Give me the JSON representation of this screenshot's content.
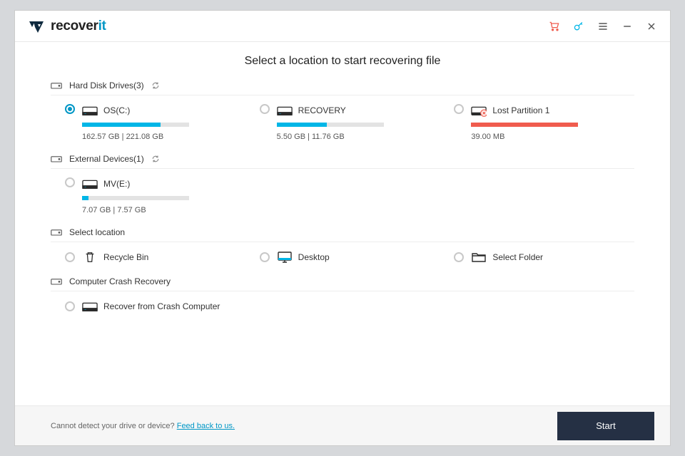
{
  "brand": {
    "left": "recover",
    "right": "it"
  },
  "page_title": "Select a location to start recovering file",
  "sections": {
    "hdd": {
      "title": "Hard Disk Drives(3)"
    },
    "ext": {
      "title": "External Devices(1)"
    },
    "sel": {
      "title": "Select location"
    },
    "crash": {
      "title": "Computer Crash Recovery"
    }
  },
  "hdd_items": [
    {
      "name": "OS(C:)",
      "size": "162.57  GB | 221.08  GB",
      "pct": 73,
      "selected": true,
      "red": false
    },
    {
      "name": "RECOVERY",
      "size": "5.50  GB | 11.76  GB",
      "pct": 47,
      "selected": false,
      "red": false
    },
    {
      "name": "Lost Partition 1",
      "size": "39.00  MB",
      "pct": 100,
      "selected": false,
      "red": true
    }
  ],
  "ext_items": [
    {
      "name": "MV(E:)",
      "size": "7.07  GB | 7.57  GB",
      "pct": 6,
      "selected": false
    }
  ],
  "sel_items": [
    {
      "name": "Recycle Bin"
    },
    {
      "name": "Desktop"
    },
    {
      "name": "Select Folder"
    }
  ],
  "crash_items": [
    {
      "name": "Recover from Crash Computer"
    }
  ],
  "footer": {
    "prompt": "Cannot detect your drive or device? ",
    "link": "Feed back to us.",
    "start": "Start"
  }
}
